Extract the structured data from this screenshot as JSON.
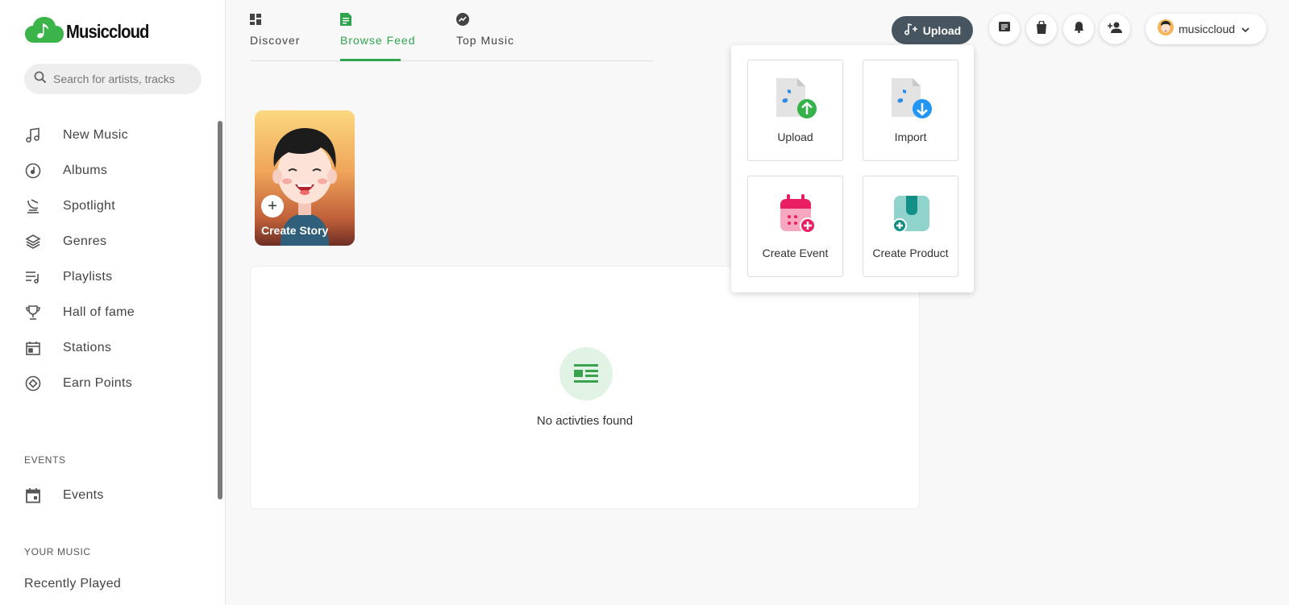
{
  "app": {
    "name": "Musiccloud"
  },
  "search": {
    "placeholder": "Search for artists, tracks"
  },
  "sidebar": {
    "items": [
      {
        "label": "New Music",
        "icon": "music-note-icon"
      },
      {
        "label": "Albums",
        "icon": "album-icon"
      },
      {
        "label": "Spotlight",
        "icon": "spotlight-icon"
      },
      {
        "label": "Genres",
        "icon": "layers-icon"
      },
      {
        "label": "Playlists",
        "icon": "playlist-icon"
      },
      {
        "label": "Hall of fame",
        "icon": "trophy-icon"
      },
      {
        "label": "Stations",
        "icon": "station-icon"
      },
      {
        "label": "Earn Points",
        "icon": "points-icon"
      }
    ],
    "events_title": "EVENTS",
    "events_items": [
      {
        "label": "Events",
        "icon": "calendar-icon"
      }
    ],
    "your_music_title": "YOUR MUSIC",
    "your_music_items": [
      {
        "label": "Recently Played"
      }
    ]
  },
  "tabs": [
    {
      "label": "Discover",
      "icon": "dashboard-icon",
      "active": false
    },
    {
      "label": "Browse Feed",
      "icon": "feed-icon",
      "active": true
    },
    {
      "label": "Top Music",
      "icon": "trending-icon",
      "active": false
    }
  ],
  "header": {
    "upload_label": "Upload",
    "user_name": "musiccloud"
  },
  "story": {
    "label": "Create Story"
  },
  "activity": {
    "empty_text": "No activties found"
  },
  "upload_menu": {
    "items": [
      {
        "label": "Upload",
        "icon": "file-upload-icon"
      },
      {
        "label": "Import",
        "icon": "file-import-icon"
      },
      {
        "label": "Create Event",
        "icon": "create-event-icon"
      },
      {
        "label": "Create Product",
        "icon": "create-product-icon"
      }
    ]
  },
  "colors": {
    "accent": "#2ea44f",
    "upload_button": "#46555f"
  }
}
